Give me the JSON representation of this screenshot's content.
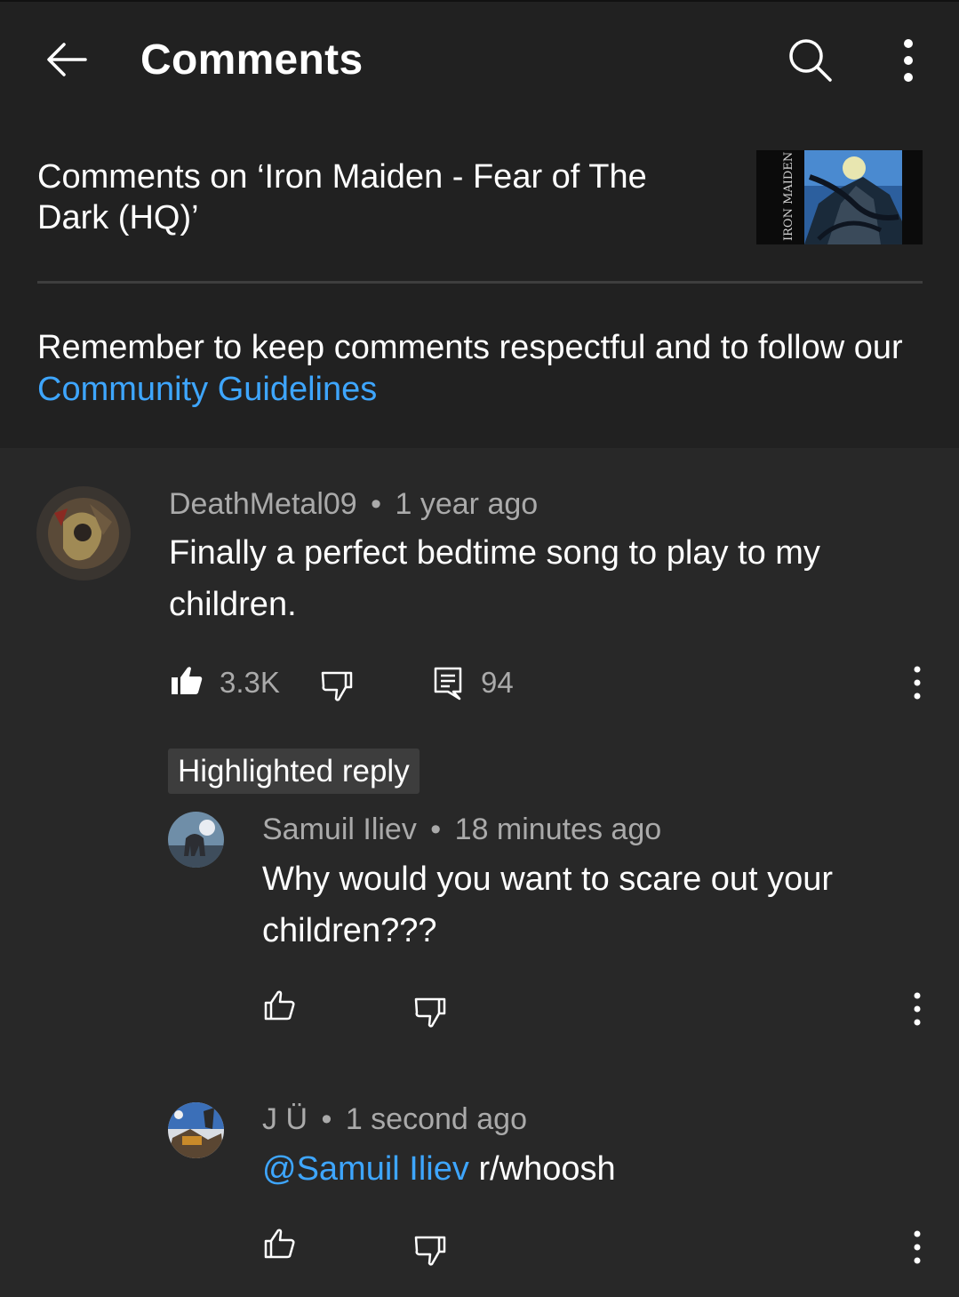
{
  "app": {
    "title": "Comments"
  },
  "icons": {
    "back": "arrow-left-icon",
    "search": "search-icon",
    "more": "more-vert-icon",
    "like_filled": "thumb-up-filled-icon",
    "like": "thumb-up-outline-icon",
    "dislike": "thumb-down-outline-icon",
    "replies": "comment-reply-icon"
  },
  "colors": {
    "background": "#282828",
    "header": "#212121",
    "link": "#3ea6ff",
    "secondary_text": "#aaaaaa"
  },
  "video": {
    "comments_title": "Comments on ‘Iron Maiden - Fear of The Dark (HQ)’",
    "thumbnail_text": "IRON MAIDEN"
  },
  "guidelines": {
    "text": "Remember to keep comments respectful and to follow our",
    "link": "Community Guidelines"
  },
  "comment": {
    "author": "DeathMetal09",
    "time": "1 year ago",
    "separator": "•",
    "text": "Finally a perfect bedtime song to play to my children.",
    "likes": "3.3K",
    "replies": "94"
  },
  "highlighted_badge": "Highlighted reply",
  "replies": [
    {
      "author": "Samuil Iliev",
      "time": "18 minutes ago",
      "separator": "•",
      "mention": "",
      "text": "Why would you want to scare out your children???"
    },
    {
      "author": "J Ü",
      "time": "1 second ago",
      "separator": "•",
      "mention": "@Samuil Iliev",
      "text": "r/whoosh"
    }
  ]
}
